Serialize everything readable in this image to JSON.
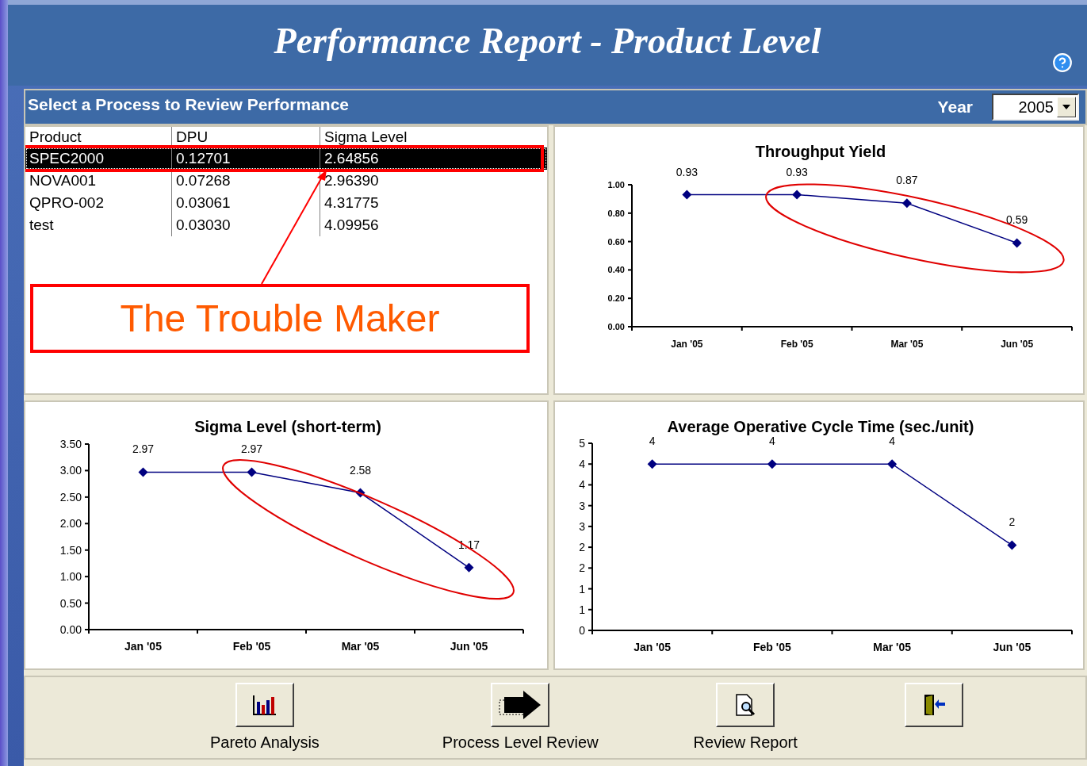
{
  "window": {
    "title": "Performance Report - Product Level"
  },
  "process_panel": {
    "heading": "Select a Process to Review Performance",
    "year_label": "Year",
    "year_value": "2005"
  },
  "table": {
    "columns": [
      "Product",
      "DPU",
      "Sigma Level"
    ],
    "rows": [
      {
        "cells": [
          "SPEC2000",
          "0.12701",
          "2.64856"
        ],
        "selected": true
      },
      {
        "cells": [
          "NOVA001",
          "0.07268",
          "2.96390"
        ],
        "selected": false
      },
      {
        "cells": [
          "QPRO-002",
          "0.03061",
          "4.31775"
        ],
        "selected": false
      },
      {
        "cells": [
          "test",
          "0.03030",
          "4.09956"
        ],
        "selected": false
      }
    ]
  },
  "callout": {
    "text": "The Trouble Maker"
  },
  "charts": [
    {
      "chart_data": {
        "type": "line",
        "title": "Throughput Yield",
        "categories": [
          "Jan '05",
          "Feb '05",
          "Mar '05",
          "Jun '05"
        ],
        "series": [
          {
            "color": "#000080",
            "marker": "diamond",
            "values": [
              0.93,
              0.93,
              0.87,
              0.59
            ]
          }
        ],
        "ylim": [
          0,
          1
        ],
        "yticks": [
          {
            "value": 0,
            "label": "0.00"
          },
          {
            "value": 0.2,
            "label": "0.20"
          },
          {
            "value": 0.4,
            "label": "0.40"
          },
          {
            "value": 0.6,
            "label": "0.60"
          },
          {
            "value": 0.8,
            "label": "0.80"
          },
          {
            "value": 1,
            "label": "1.00"
          }
        ],
        "value_labels": [
          "0.93",
          "0.93",
          "0.87",
          "0.59"
        ]
      },
      "highlighted": true
    },
    {
      "chart_data": {
        "type": "line",
        "title": "Sigma Level (short-term)",
        "categories": [
          "Jan '05",
          "Feb '05",
          "Mar '05",
          "Jun '05"
        ],
        "series": [
          {
            "color": "#000080",
            "marker": "diamond",
            "values": [
              2.97,
              2.97,
              2.58,
              1.17
            ]
          }
        ],
        "ylim": [
          0,
          3.5
        ],
        "yticks": [
          {
            "value": 0,
            "label": "0.00"
          },
          {
            "value": 0.5,
            "label": "0.50"
          },
          {
            "value": 1,
            "label": "1.00"
          },
          {
            "value": 1.5,
            "label": "1.50"
          },
          {
            "value": 2,
            "label": "2.00"
          },
          {
            "value": 2.5,
            "label": "2.50"
          },
          {
            "value": 3,
            "label": "3.00"
          },
          {
            "value": 3.5,
            "label": "3.50"
          }
        ],
        "value_labels": [
          "2.97",
          "2.97",
          "2.58",
          "1.17"
        ]
      },
      "highlighted": true
    },
    {
      "chart_data": {
        "type": "line",
        "title": "Average Operative Cycle Time (sec./unit)",
        "categories": [
          "Jan '05",
          "Feb '05",
          "Mar '05",
          "Jun '05"
        ],
        "series": [
          {
            "color": "#000080",
            "marker": "diamond",
            "values": [
              4,
              4,
              4,
              2.05
            ]
          }
        ],
        "ylim": [
          0,
          4.5
        ],
        "yticks": [
          {
            "value": 0,
            "label": "0"
          },
          {
            "value": 0.5,
            "label": "1"
          },
          {
            "value": 1,
            "label": "1"
          },
          {
            "value": 1.5,
            "label": "2"
          },
          {
            "value": 2,
            "label": "2"
          },
          {
            "value": 2.5,
            "label": "3"
          },
          {
            "value": 3,
            "label": "3"
          },
          {
            "value": 3.5,
            "label": "4"
          },
          {
            "value": 4,
            "label": "4"
          },
          {
            "value": 4.5,
            "label": "5"
          }
        ],
        "value_labels": [
          "4",
          "4",
          "4",
          "2"
        ]
      },
      "highlighted": false
    }
  ],
  "toolbar": [
    {
      "kind": "pareto",
      "label": "Pareto Analysis"
    },
    {
      "kind": "process",
      "label": "Process Level Review"
    },
    {
      "kind": "report",
      "label": "Review Report"
    },
    {
      "kind": "exit"
    }
  ]
}
